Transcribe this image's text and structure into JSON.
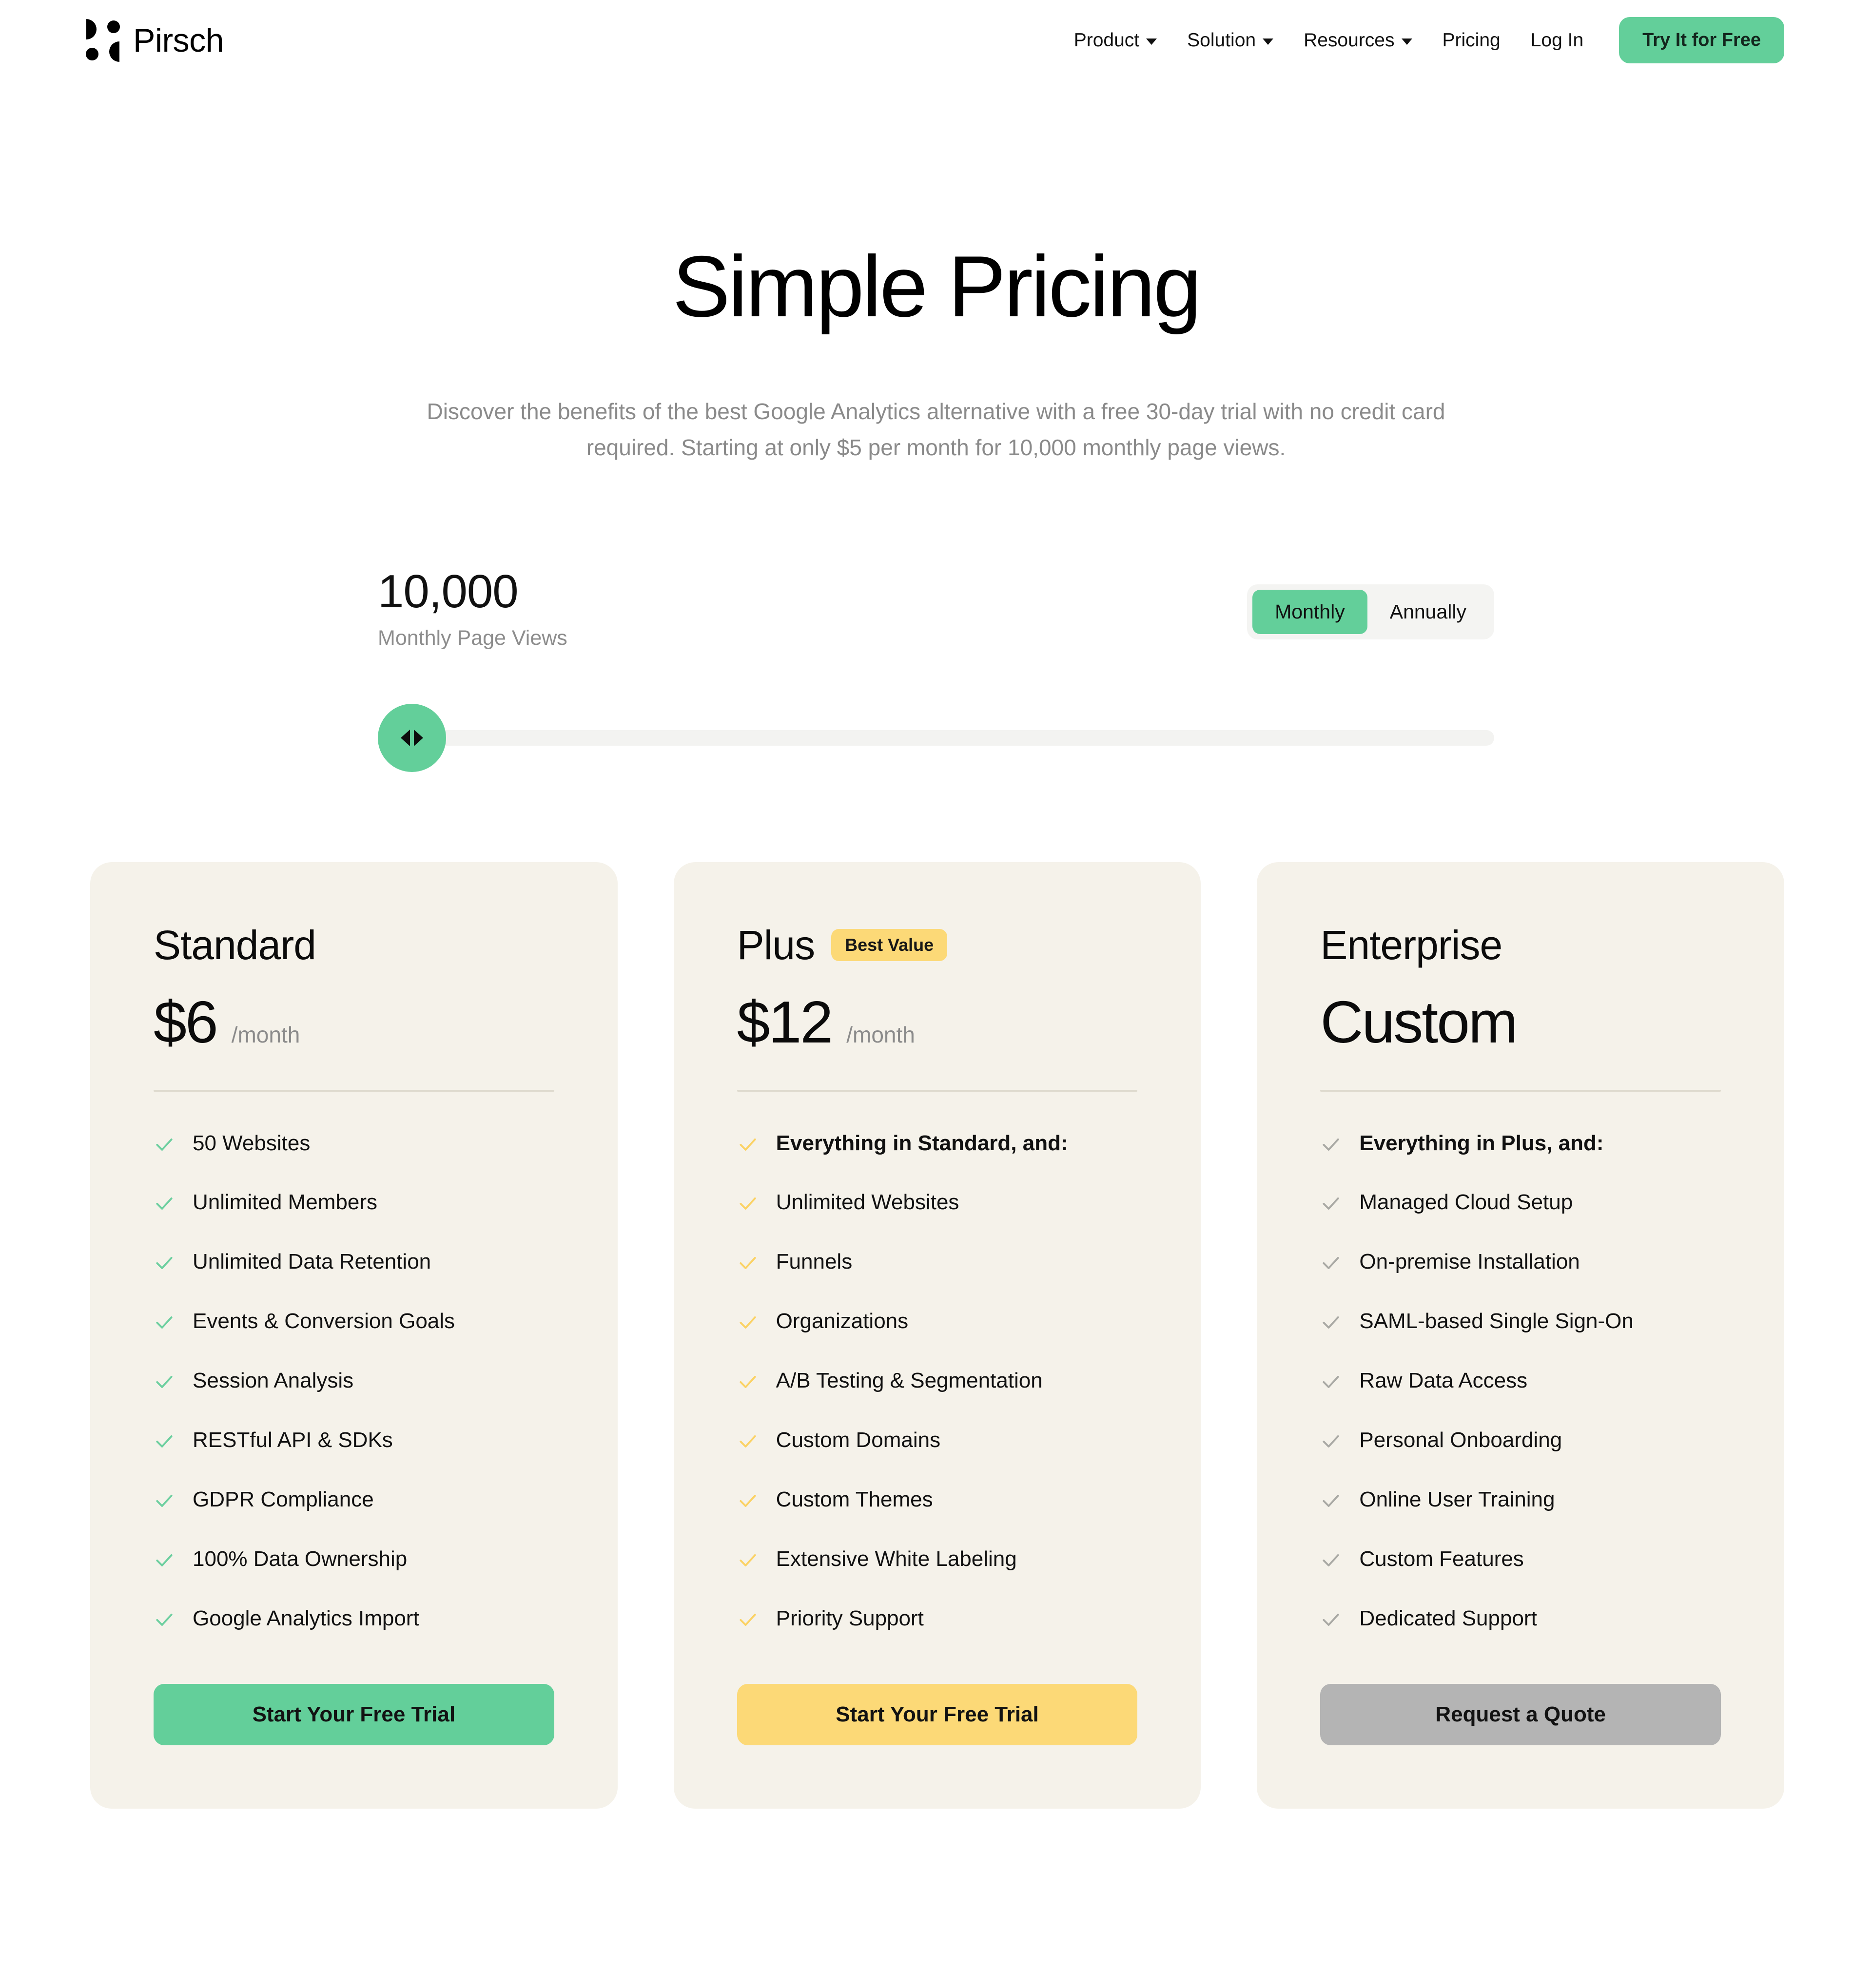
{
  "nav": {
    "brand": "Pirsch",
    "links": [
      {
        "label": "Product",
        "has_caret": true
      },
      {
        "label": "Solution",
        "has_caret": true
      },
      {
        "label": "Resources",
        "has_caret": true
      },
      {
        "label": "Pricing",
        "has_caret": false
      },
      {
        "label": "Log In",
        "has_caret": false
      }
    ],
    "cta": "Try It for Free"
  },
  "hero": {
    "title": "Simple Pricing",
    "subtitle": "Discover the benefits of the best Google Analytics alternative with a free 30-day trial with no credit card required. Starting at only $5 per month for 10,000 monthly page views."
  },
  "controls": {
    "views_value": "10,000",
    "views_label": "Monthly Page Views",
    "billing": {
      "options": [
        "Monthly",
        "Annually"
      ],
      "selected": "Monthly"
    },
    "slider": {
      "position_percent": 0,
      "value": "10,000"
    }
  },
  "colors": {
    "green": "#63cf9a",
    "yellow": "#fcd977",
    "gray": "#b4b4b4",
    "card_bg": "#f5f2ea",
    "check_green": "#6ccf9f",
    "check_yellow": "#fbd264",
    "check_gray": "#a9a9a4"
  },
  "plans": [
    {
      "name": "Standard",
      "badge": null,
      "price": "$6",
      "per": "/month",
      "check_color": "#6ccf9f",
      "features": [
        {
          "text": "50 Websites",
          "bold": false
        },
        {
          "text": "Unlimited Members",
          "bold": false
        },
        {
          "text": "Unlimited Data Retention",
          "bold": false
        },
        {
          "text": "Events & Conversion Goals",
          "bold": false
        },
        {
          "text": "Session Analysis",
          "bold": false
        },
        {
          "text": "RESTful API & SDKs",
          "bold": false
        },
        {
          "text": "GDPR Compliance",
          "bold": false
        },
        {
          "text": "100% Data Ownership",
          "bold": false
        },
        {
          "text": "Google Analytics Import",
          "bold": false
        }
      ],
      "cta": {
        "label": "Start Your Free Trial",
        "style": "btn-green"
      }
    },
    {
      "name": "Plus",
      "badge": "Best Value",
      "price": "$12",
      "per": "/month",
      "check_color": "#fbd264",
      "features": [
        {
          "text": "Everything in Standard, and:",
          "bold": true
        },
        {
          "text": "Unlimited Websites",
          "bold": false
        },
        {
          "text": "Funnels",
          "bold": false
        },
        {
          "text": "Organizations",
          "bold": false
        },
        {
          "text": "A/B Testing & Segmentation",
          "bold": false
        },
        {
          "text": "Custom Domains",
          "bold": false
        },
        {
          "text": "Custom Themes",
          "bold": false
        },
        {
          "text": "Extensive White Labeling",
          "bold": false
        },
        {
          "text": "Priority Support",
          "bold": false
        }
      ],
      "cta": {
        "label": "Start Your Free Trial",
        "style": "btn-yellow"
      }
    },
    {
      "name": "Enterprise",
      "badge": null,
      "price": "Custom",
      "per": "",
      "check_color": "#a9a9a4",
      "features": [
        {
          "text": "Everything in Plus, and:",
          "bold": true
        },
        {
          "text": "Managed Cloud Setup",
          "bold": false
        },
        {
          "text": "On-premise Installation",
          "bold": false
        },
        {
          "text": "SAML-based Single Sign-On",
          "bold": false
        },
        {
          "text": "Raw Data Access",
          "bold": false
        },
        {
          "text": "Personal Onboarding",
          "bold": false
        },
        {
          "text": "Online User Training",
          "bold": false
        },
        {
          "text": "Custom Features",
          "bold": false
        },
        {
          "text": "Dedicated Support",
          "bold": false
        }
      ],
      "cta": {
        "label": "Request a Quote",
        "style": "btn-gray"
      }
    }
  ]
}
